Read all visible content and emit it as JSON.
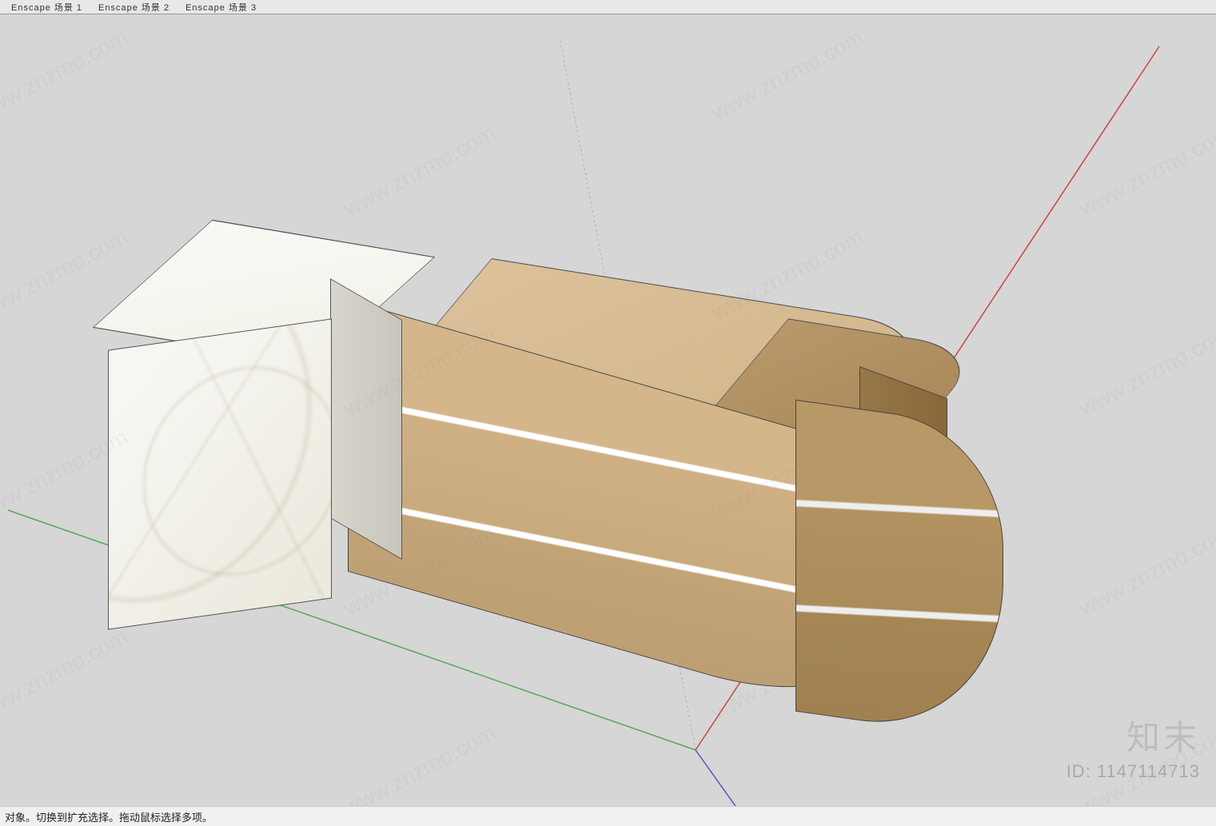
{
  "scene_tabs": [
    {
      "label": "Enscape 场景 1"
    },
    {
      "label": "Enscape 场景 2"
    },
    {
      "label": "Enscape 场景 3"
    }
  ],
  "status_bar": {
    "text": "对象。切换到扩充选择。拖动鼠标选择多项。"
  },
  "watermark": {
    "url_text": "www.znzmo.com",
    "brand_name": "知末",
    "id_label": "ID: 1147114713"
  }
}
